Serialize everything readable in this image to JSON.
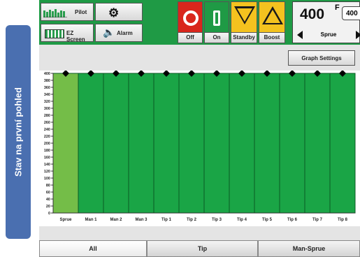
{
  "sidebar": {
    "caption": "Stav na první pohled"
  },
  "toolbar": {
    "pilot_label": "Pilot",
    "ez_screen_label": "EZ Screen",
    "alarm_label": "Alarm",
    "off_label": "Off",
    "on_label": "On",
    "standby_label": "Standby",
    "boost_label": "Boost"
  },
  "temperature": {
    "value": "400",
    "unit": "F",
    "secondary": "400",
    "zone": "Sprue"
  },
  "graph_settings_label": "Graph Settings",
  "chart_data": {
    "type": "bar",
    "categories": [
      "Sprue",
      "Man 1",
      "Man 2",
      "Man 3",
      "Tip 1",
      "Tip 2",
      "Tip 3",
      "Tip 4",
      "Tip 5",
      "Tip 6",
      "Tip 7",
      "Tip 8"
    ],
    "values": [
      400,
      400,
      400,
      400,
      400,
      400,
      400,
      400,
      400,
      400,
      400,
      400
    ],
    "setpoints": [
      400,
      400,
      400,
      400,
      400,
      400,
      400,
      400,
      400,
      400,
      400,
      400
    ],
    "yticks": [
      0,
      20,
      40,
      60,
      80,
      100,
      120,
      140,
      160,
      180,
      200,
      220,
      240,
      260,
      280,
      300,
      320,
      340,
      360,
      380,
      400
    ],
    "ylim": [
      0,
      400
    ],
    "grid": false,
    "colors": {
      "selected": "#74bd48",
      "normal": "#1aa546",
      "marker": "#000000"
    }
  },
  "tabs": [
    {
      "label": "All",
      "active": true
    },
    {
      "label": "Tip",
      "active": false
    },
    {
      "label": "Man-Sprue",
      "active": false
    }
  ],
  "colors": {
    "topbar": "#1f9a45",
    "off_red": "#d9261c",
    "sidebar_badge": "#4a6fb0"
  }
}
